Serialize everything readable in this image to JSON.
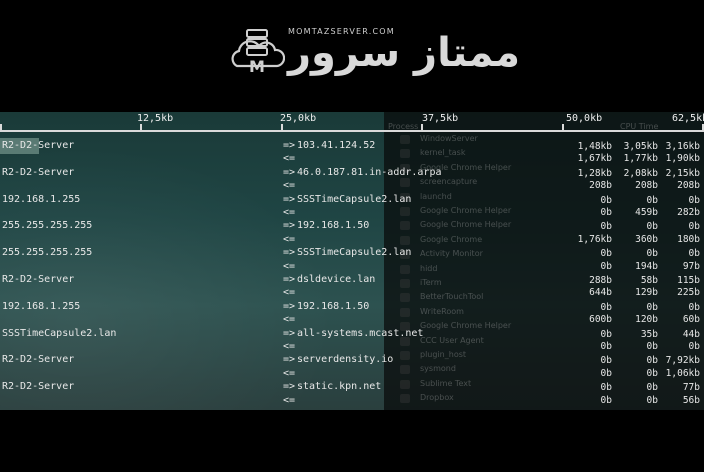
{
  "logo": {
    "url_text": "MOMTAZSERVER.COM",
    "brand_text": "ممتاز سرور",
    "icon": "server-cloud-m-icon"
  },
  "scale": [
    "12,5kb",
    "25,0kb",
    "37,5kb",
    "50,0kb",
    "62,5kb"
  ],
  "process_header": {
    "process": "Process",
    "cpu_time": "CPU Time"
  },
  "processes": [
    "WindowServer",
    "kernel_task",
    "Google Chrome Helper",
    "screencapture",
    "launchd",
    "Google Chrome Helper",
    "Google Chrome Helper",
    "Google Chrome",
    "Activity Monitor",
    "hidd",
    "iTerm",
    "BetterTouchTool",
    "WriteRoom",
    "Google Chrome Helper",
    "CCC User Agent",
    "plugin_host",
    "sysmond",
    "Sublime Text",
    "Dropbox"
  ],
  "connections": [
    {
      "src": "R2-D2-Server",
      "dst": "103.41.124.52",
      "out": [
        "1,48kb",
        "3,05kb",
        "3,16kb"
      ],
      "in": [
        "1,67kb",
        "1,77kb",
        "1,90kb"
      ]
    },
    {
      "src": "R2-D2-Server",
      "dst": "46.0.187.81.in-addr.arpa",
      "out": [
        "1,28kb",
        "2,08kb",
        "2,15kb"
      ],
      "in": [
        "208b",
        "208b",
        "208b"
      ]
    },
    {
      "src": "192.168.1.255",
      "dst": "SSSTimeCapsule2.lan",
      "out": [
        "0b",
        "0b",
        "0b"
      ],
      "in": [
        "0b",
        "459b",
        "282b"
      ]
    },
    {
      "src": "255.255.255.255",
      "dst": "192.168.1.50",
      "out": [
        "0b",
        "0b",
        "0b"
      ],
      "in": [
        "1,76kb",
        "360b",
        "180b"
      ]
    },
    {
      "src": "255.255.255.255",
      "dst": "SSSTimeCapsule2.lan",
      "out": [
        "0b",
        "0b",
        "0b"
      ],
      "in": [
        "0b",
        "194b",
        "97b"
      ]
    },
    {
      "src": "R2-D2-Server",
      "dst": "dsldevice.lan",
      "out": [
        "288b",
        "58b",
        "115b"
      ],
      "in": [
        "644b",
        "129b",
        "225b"
      ]
    },
    {
      "src": "192.168.1.255",
      "dst": "192.168.1.50",
      "out": [
        "0b",
        "0b",
        "0b"
      ],
      "in": [
        "600b",
        "120b",
        "60b"
      ]
    },
    {
      "src": "SSSTimeCapsule2.lan",
      "dst": "all-systems.mcast.net",
      "out": [
        "0b",
        "35b",
        "44b"
      ],
      "in": [
        "0b",
        "0b",
        "0b"
      ]
    },
    {
      "src": "R2-D2-Server",
      "dst": "serverdensity.io",
      "out": [
        "0b",
        "0b",
        "7,92kb"
      ],
      "in": [
        "0b",
        "0b",
        "1,06kb"
      ]
    },
    {
      "src": "R2-D2-Server",
      "dst": "static.kpn.net",
      "out": [
        "0b",
        "0b",
        "77b"
      ],
      "in": [
        "0b",
        "0b",
        "56b"
      ]
    }
  ],
  "arrows": {
    "out": "=>",
    "in": "<="
  }
}
